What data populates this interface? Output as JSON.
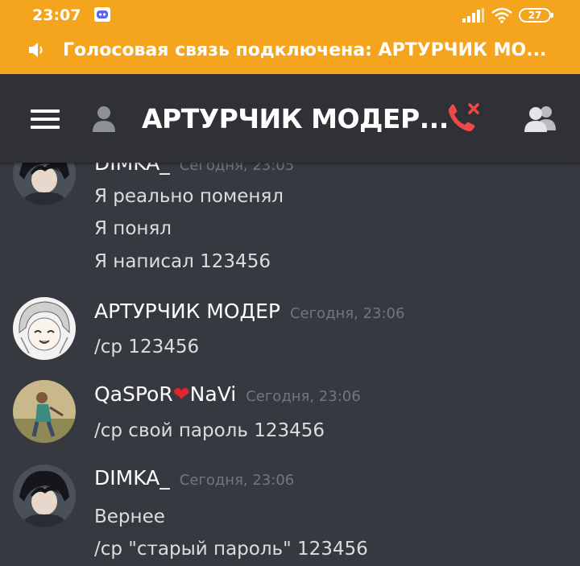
{
  "status_bar": {
    "time": "23:07",
    "battery": "27"
  },
  "voice_banner": {
    "text": "Голосовая связь подключена: АРТУРЧИК МО..."
  },
  "header": {
    "title": "АРТУРЧИК МОДЕР..."
  },
  "messages": [
    {
      "author": "DIMKA_",
      "timestamp": "Сегодня, 23:05",
      "lines": [
        "Я реально поменял",
        "Я понял",
        "Я написал 123456"
      ]
    },
    {
      "author": "АРТУРЧИК МОДЕР",
      "timestamp": "Сегодня, 23:06",
      "lines": [
        "/cp 123456"
      ]
    },
    {
      "author_part1": "QaSPoR",
      "author_heart": "❤",
      "author_part2": "NaVi",
      "timestamp": "Сегодня, 23:06",
      "lines": [
        "/cp свой пароль 123456"
      ]
    },
    {
      "author": "DIMKA_",
      "timestamp": "Сегодня, 23:06",
      "lines": [
        "Вернее",
        "/cp \"старый пароль\" 123456"
      ]
    }
  ],
  "colors": {
    "status_bar": "#f5a41e",
    "header_bg": "#2f3136",
    "chat_bg": "#36393f",
    "hangup_red": "#f04747"
  },
  "icons": [
    "discord-icon",
    "signal-icon",
    "wifi-icon",
    "battery-icon",
    "speaker-icon",
    "hamburger-menu-icon",
    "dm-user-icon",
    "hang-up-icon",
    "members-icon"
  ]
}
